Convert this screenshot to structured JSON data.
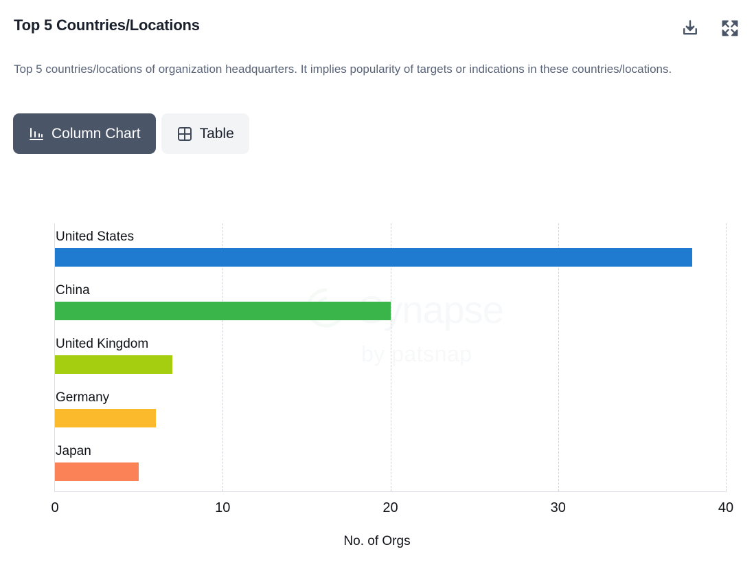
{
  "header": {
    "title": "Top 5 Countries/Locations",
    "download_icon": "download-icon",
    "expand_icon": "expand-icon"
  },
  "description": "Top 5 countries/locations of organization headquarters. It implies popularity of targets or indications in these countries/locations.",
  "view_toggle": {
    "options": [
      {
        "label": "Column Chart",
        "icon": "bar-chart-icon",
        "active": true
      },
      {
        "label": "Table",
        "icon": "grid-icon",
        "active": false
      }
    ]
  },
  "watermark": {
    "main": "Synapse",
    "sub": "by patsnap"
  },
  "colors": {
    "active_toggle_bg": "#4a5568",
    "inactive_toggle_bg": "#f3f4f6",
    "title": "#1a202c",
    "description": "#5a6478",
    "gridline": "#cfd2d8",
    "axis": "#dcdee3"
  },
  "chart_data": {
    "type": "bar",
    "orientation": "horizontal",
    "title": "Top 5 Countries/Locations",
    "categories": [
      "United States",
      "China",
      "United Kingdom",
      "Germany",
      "Japan"
    ],
    "values": [
      38,
      20,
      7,
      6,
      5
    ],
    "colors": [
      "#1f7bd0",
      "#3ab54a",
      "#a6ce11",
      "#fbb92c",
      "#fb8157"
    ],
    "xlabel": "No. of Orgs",
    "ylabel": "",
    "xlim": [
      0,
      40
    ],
    "xticks": [
      0,
      10,
      20,
      30,
      40
    ],
    "xtick_labels": [
      "0",
      "10",
      "20",
      "30",
      "40"
    ],
    "grid": true,
    "grid_style": "dashed-vertical",
    "legend": false,
    "labels_position": "above-bar"
  }
}
